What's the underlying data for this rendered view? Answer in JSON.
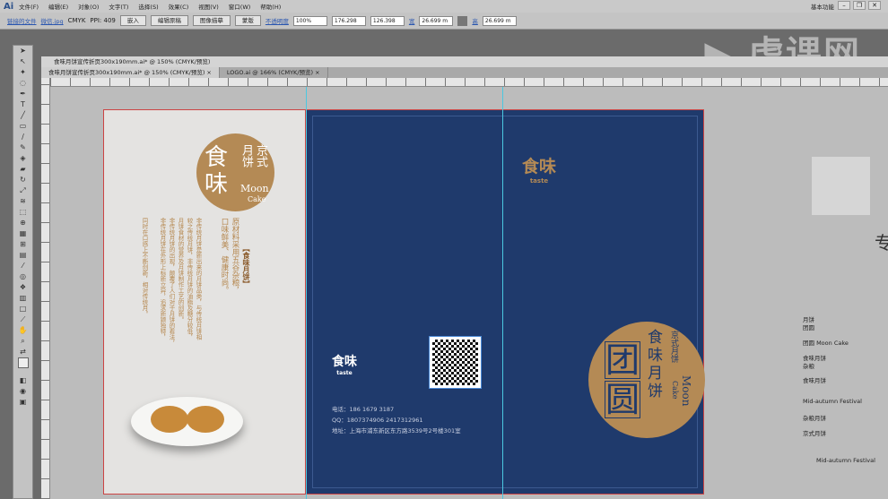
{
  "app": {
    "logo": "Ai",
    "menu": [
      "文件(F)",
      "编辑(E)",
      "对象(O)",
      "文字(T)",
      "选择(S)",
      "效果(C)",
      "视图(V)",
      "窗口(W)",
      "帮助(H)"
    ],
    "workspace": "基本功能",
    "watermark": "虎课网"
  },
  "control": {
    "linked_file": "链接的文件",
    "file_name": "微信.jpg",
    "color_mode": "CMYK",
    "ppi": "PPI: 409",
    "embed": "嵌入",
    "edit_original": "编辑原稿",
    "image_trace": "图像描摹",
    "mask": "蒙版",
    "opacity_label": "不透明度",
    "opacity": "100%",
    "x": "176.298",
    "y": "126.398",
    "w": "26.699 m",
    "h": "26.699 m",
    "w_label": "宽",
    "h_label": "高"
  },
  "document": {
    "title": "食味月饼宣传折页300x190mm.ai* @ 150% (CMYK/预览)",
    "tabs": [
      "食味月饼宣传折页300x190mm.ai* @ 150% (CMYK/预览)",
      "LOGO.ai @ 166% (CMYK/预览)"
    ]
  },
  "left_panel": {
    "logo_big": "食味",
    "logo_sub": "京式月饼",
    "logo_en1": "Moon",
    "logo_en2": "Cake",
    "heading": "【食味月饼】",
    "intro": [
      "原材料采用五谷杂粮，",
      "口味鲜美、健康时尚。"
    ],
    "body": [
      "非传统月饼是新出来的月饼品类，与传统月饼相",
      "较之传统月饼，非传统月饼的油脂及糖分较低，",
      "月饼食材的营养及月饼制作工艺的创新。",
      "非传统月饼的出现，颠覆了人们对于月饼的看法，",
      "非传统月饼在外形上标新立异，追求新颖独特，",
      "同时在口感上不断创新，相对传统月。"
    ]
  },
  "center_panel": {
    "logo": "食味",
    "logo_en": "taste",
    "phone": "电话：186 1679 3187",
    "qq": "QQ：1807374906   2417312961",
    "address": "地址：上海市浦东新区东方路3539号2号楼301室"
  },
  "right_panel": {
    "logo": "食味",
    "logo_en": "taste",
    "big": [
      "团",
      "圆"
    ],
    "title": "食味月饼",
    "sub": "京式月饼",
    "en1": "Moon",
    "en2": "Cake"
  },
  "canvas_notes": [
    "月饼",
    "团圆",
    "团圆 Moon Cake",
    "食味月饼",
    "杂粮",
    "食味月饼",
    "Mid-autumn Festival",
    "杂粮月饼",
    "京式月饼",
    "Mid-autumn Festival"
  ],
  "canvas_char": "专",
  "colors": {
    "navy": "#1f3a6c",
    "gold": "#b48a55",
    "paper": "#e4e3e1"
  }
}
